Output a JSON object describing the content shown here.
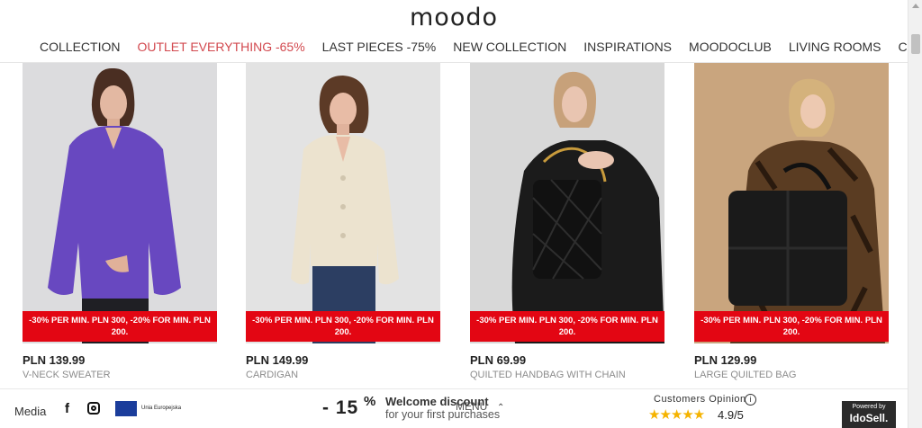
{
  "brand": {
    "logo": "moodo"
  },
  "nav": {
    "items": [
      {
        "label": "COLLECTION"
      },
      {
        "label": "OUTLET EVERYTHING -65%"
      },
      {
        "label": "LAST PIECES -75%"
      },
      {
        "label": "NEW COLLECTION"
      },
      {
        "label": "INSPIRATIONS"
      },
      {
        "label": "MOODOCLUB"
      },
      {
        "label": "LIVING ROOMS"
      },
      {
        "label": "CONTACT"
      }
    ],
    "accent_color": "#d2484e"
  },
  "products": [
    {
      "promo": "-30% PER MIN. PLN 300, -20% FOR MIN. PLN 200.",
      "price": "PLN 139.99",
      "name": "V-NECK SWEATER",
      "bg_color": "#dcdcde",
      "item_color": "#6848c0"
    },
    {
      "promo": "-30% PER MIN. PLN 300, -20% FOR MIN. PLN 200.",
      "price": "PLN 149.99",
      "name": "CARDIGAN",
      "bg_color": "#e3e3e3",
      "item_color": "#ece3cf"
    },
    {
      "promo": "-30% PER MIN. PLN 300, -20% FOR MIN. PLN 200.",
      "price": "PLN 69.99",
      "name": "QUILTED HANDBAG WITH CHAIN",
      "bg_color": "#d8d8d8",
      "item_color": "#1b1b1b"
    },
    {
      "promo": "-30% PER MIN. PLN 300, -20% FOR MIN. PLN 200.",
      "price": "PLN 129.99",
      "name": "LARGE QUILTED BAG",
      "bg_color": "#c9a57e",
      "item_color": "#1a1a1a"
    }
  ],
  "promo_color": "#e30613",
  "footer": {
    "media_label": "Media",
    "facebook_icon": "f",
    "eu_label": "Unia Europejska",
    "discount_value": "- 15",
    "discount_symbol": "%",
    "welcome_title": "Welcome discount",
    "welcome_sub": "for your first purchases",
    "menu_label": "MENU",
    "menu_chevron": "⌃",
    "customers_opinion": "Customers Opinion",
    "info_icon": "i",
    "stars": "★★★★★",
    "rating": "4.9/5",
    "powered_by": "Powered by",
    "powered_brand": "IdoSell."
  }
}
